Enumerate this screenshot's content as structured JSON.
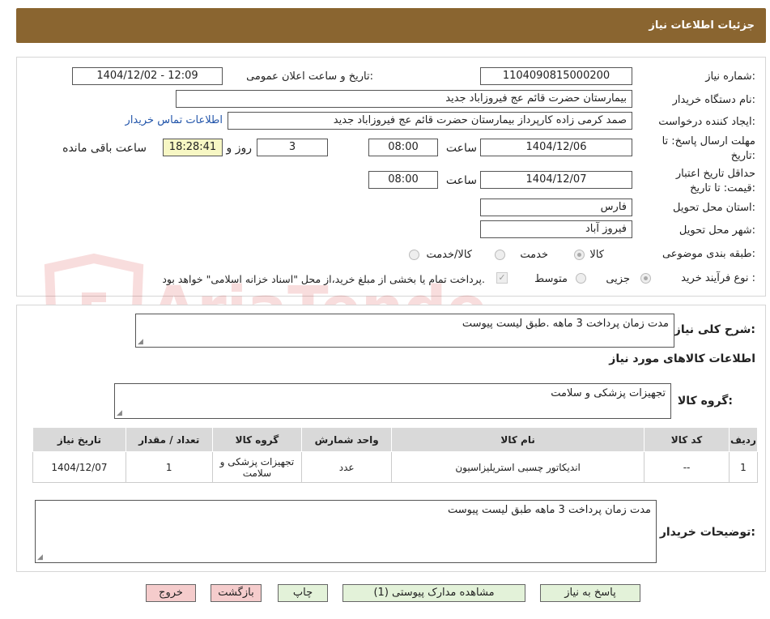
{
  "header": {
    "title": "جزئیات اطلاعات نیاز"
  },
  "watermark": {
    "text": "AriaTender.neT"
  },
  "form": {
    "need_number_label": "شماره نیاز:",
    "need_number": "1104090815000200",
    "announce_label": "تاریخ و ساعت اعلان عمومی:",
    "announce_value": "1404/12/02 - 12:09",
    "buyer_org_label": "نام دستگاه خریدار:",
    "buyer_org": "بیمارستان حضرت قائم  عج  فیروزاباد جدید",
    "creator_label": "ایجاد کننده درخواست:",
    "creator": "صمد کرمی زاده کارپرداز بیمارستان حضرت قائم  عج  فیروزاباد جدید",
    "contact_link": "اطلاعات تماس خریدار",
    "reply_deadline_label_1": "مهلت ارسال پاسخ: تا",
    "reply_deadline_label_2": "تاریخ:",
    "reply_date": "1404/12/06",
    "time_label": "ساعت",
    "reply_time": "08:00",
    "days_value": "3",
    "days_label": "روز و",
    "remaining_time": "18:28:41",
    "remaining_label": "ساعت باقی مانده",
    "validity_label_1": "حداقل تاریخ اعتبار",
    "validity_label_2": "قیمت: تا تاریخ:",
    "validity_date": "1404/12/07",
    "validity_time": "08:00",
    "province_label": "استان محل تحویل:",
    "province": "فارس",
    "city_label": "شهر محل تحویل:",
    "city": "فیروز آباد",
    "category_label": "طبقه بندی موضوعی:",
    "category_options": [
      "کالا",
      "خدمت",
      "کالا/خدمت"
    ],
    "category_selected": "کالا",
    "purchase_type_label": "نوع فرآیند خرید :",
    "purchase_options": [
      "جزیی",
      "متوسط"
    ],
    "purchase_selected": "جزیی",
    "payment_note": "پرداخت تمام یا بخشی از مبلغ خرید،از محل \"اسناد خزانه اسلامی\" خواهد بود."
  },
  "details": {
    "summary_label": "شرح کلی نیاز:",
    "summary": "مدت زمان پرداخت 3 ماهه .طبق لیست پیوست",
    "goods_info_title": "اطلاعات کالاهای مورد نیاز",
    "goods_group_label": "گروه کالا:",
    "goods_group": "تجهیزات پزشکی و سلامت",
    "table": {
      "headers": [
        "ردیف",
        "کد کالا",
        "نام کالا",
        "واحد شمارش",
        "گروه کالا",
        "تعداد / مقدار",
        "تاریخ نیاز"
      ],
      "rows": [
        [
          "1",
          "--",
          "اندیکاتور چسبی استریلیزاسیون",
          "عدد",
          "تجهیزات پزشکی و سلامت",
          "1",
          "1404/12/07"
        ]
      ]
    },
    "buyer_notes_label": "توضیحات خریدار:",
    "buyer_notes": "مدت زمان پرداخت 3 ماهه طبق لیست پیوست"
  },
  "buttons": {
    "reply": "پاسخ به نیاز",
    "attachments": "مشاهده مدارک پیوستی (1)",
    "print": "چاپ",
    "back": "بازگشت",
    "exit": "خروج"
  }
}
